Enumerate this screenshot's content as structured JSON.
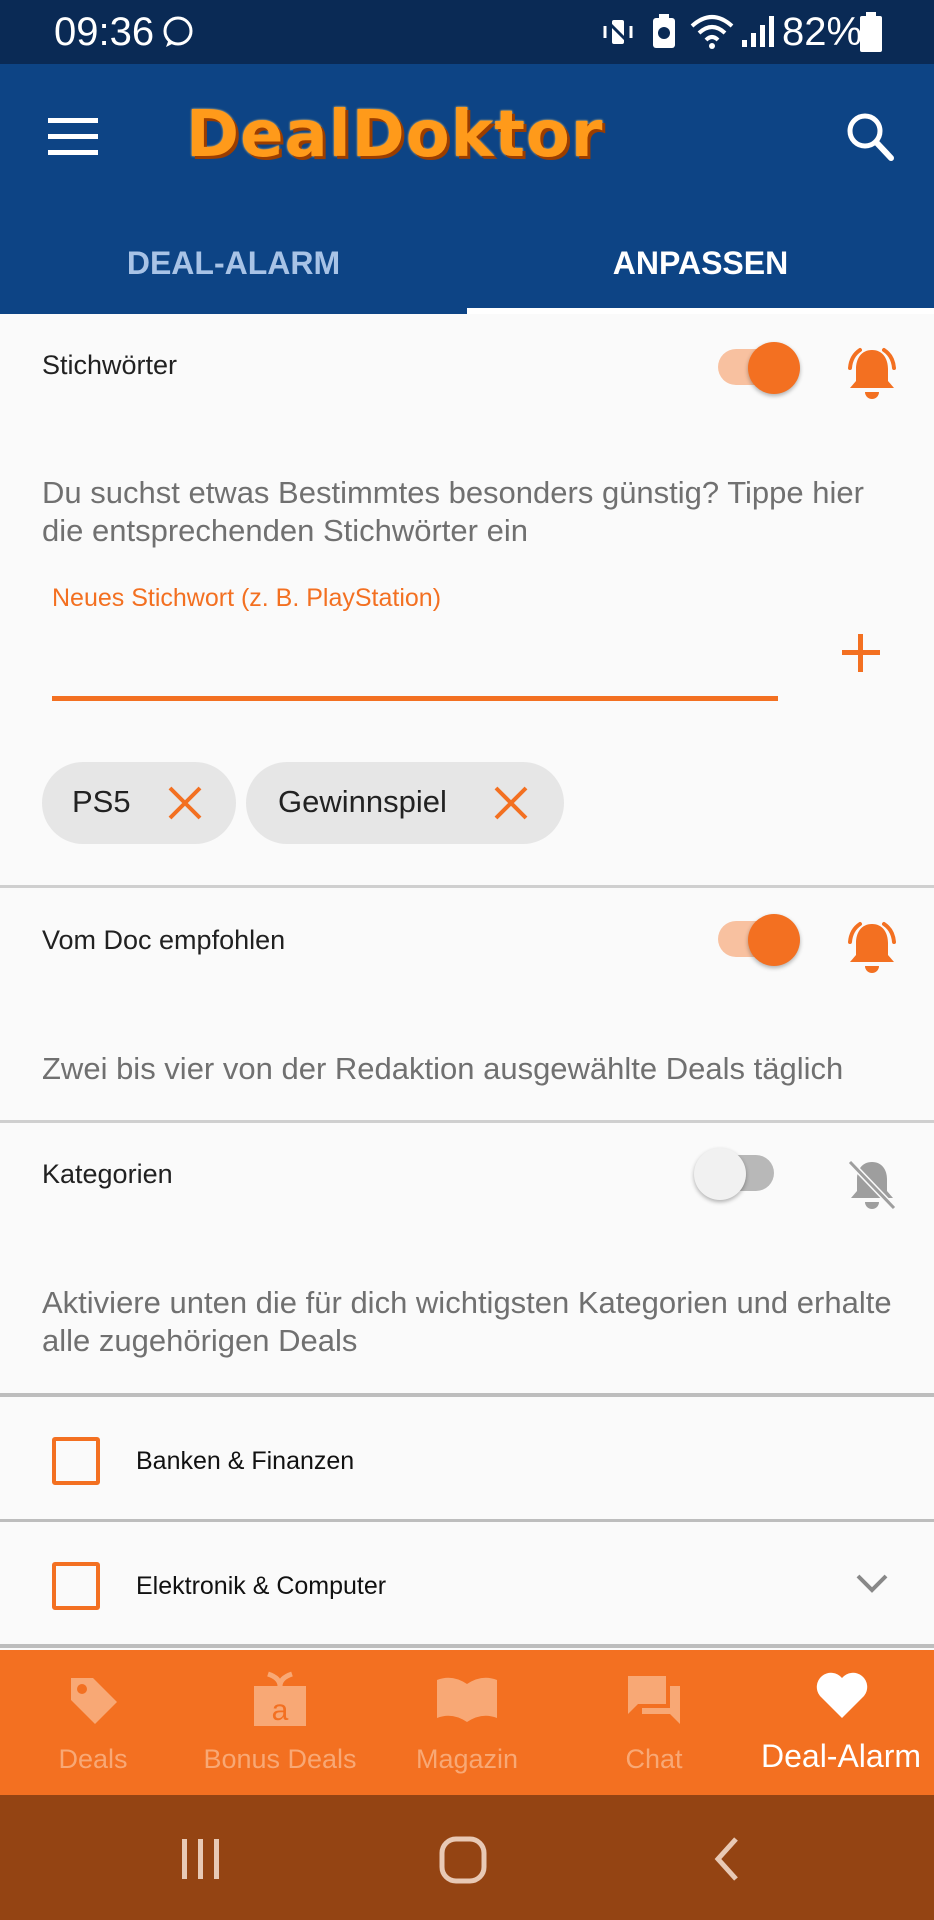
{
  "status_bar": {
    "time": "09:36",
    "battery": "82%"
  },
  "app": {
    "logo": "DealDoktor"
  },
  "tabs": [
    {
      "label": "DEAL-ALARM"
    },
    {
      "label": "ANPASSEN"
    }
  ],
  "keywords": {
    "title": "Stichwörter",
    "enabled": true,
    "description": "Du suchst etwas Bestimmtes besonders günstig? Tippe hier die entsprechenden Stichwörter ein",
    "input_hint": "Neues Stichwort (z. B. PlayStation)",
    "input_value": "",
    "chips": [
      {
        "label": "PS5"
      },
      {
        "label": "Gewinnspiel"
      }
    ]
  },
  "recommended": {
    "title": "Vom Doc empfohlen",
    "enabled": true,
    "description": "Zwei bis vier von der Redaktion ausgewählte Deals täglich"
  },
  "categories": {
    "title": "Kategorien",
    "enabled": false,
    "description": "Aktiviere unten die für dich wichtigsten Kategorien und erhalte alle zugehörigen Deals",
    "items": [
      {
        "label": "Banken & Finanzen",
        "checked": false
      },
      {
        "label": "Elektronik & Computer",
        "checked": false
      }
    ]
  },
  "bottom_nav": [
    {
      "label": "Deals",
      "icon": "tag-icon"
    },
    {
      "label": "Bonus Deals",
      "icon": "gift-icon"
    },
    {
      "label": "Magazin",
      "icon": "book-icon"
    },
    {
      "label": "Chat",
      "icon": "chat-icon"
    },
    {
      "label": "Deal-Alarm",
      "icon": "heart-icon",
      "active": true
    }
  ],
  "colors": {
    "primary": "#0d4485",
    "accent": "#f37021",
    "status_bar": "#0a2a55",
    "system_nav": "#944413"
  }
}
